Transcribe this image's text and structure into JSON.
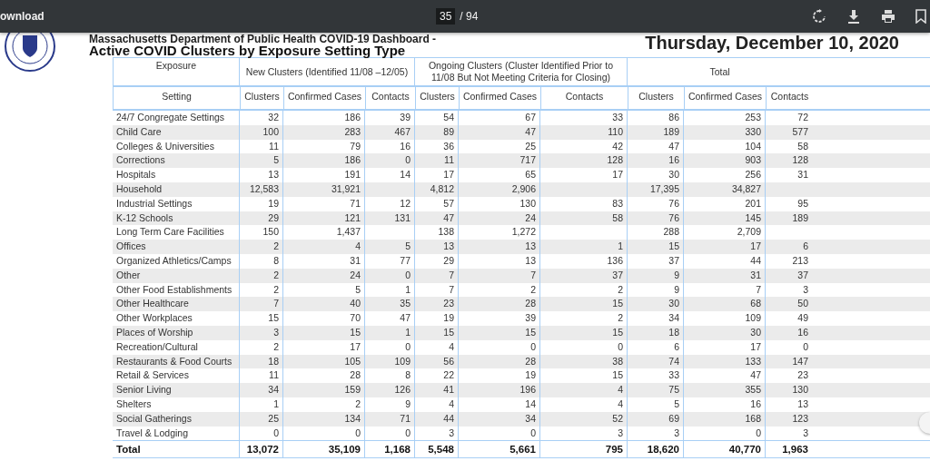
{
  "toolbar": {
    "title": "ownload",
    "page": "35",
    "page_count": "/ 94"
  },
  "header": {
    "agency": "Massachusetts Department of Public Health COVID-19 Dashboard -",
    "date": "Thursday, December 10, 2020",
    "title": "Active COVID Clusters by Exposure Setting Type"
  },
  "table": {
    "groups": [
      {
        "label": "Exposure"
      },
      {
        "label": "New Clusters (Identified 11/08 –12/05)"
      },
      {
        "label": "Ongoing Clusters (Cluster Identified Prior to 11/08 But Not Meeting Criteria for Closing)"
      },
      {
        "label": "Total"
      }
    ],
    "columns": [
      "Setting",
      "Clusters",
      "Confirmed Cases",
      "Contacts",
      "Clusters",
      "Confirmed Cases",
      "Contacts",
      "Clusters",
      "Confirmed Cases",
      "Contacts"
    ],
    "rows": [
      {
        "setting": "24/7 Congregate Settings",
        "new_clusters": "32",
        "new_cases": "186",
        "new_contacts": "39",
        "ongoing_clusters": "54",
        "ongoing_cases": "67",
        "ongoing_contacts": "33",
        "total_clusters": "86",
        "total_cases": "253",
        "total_contacts": "72"
      },
      {
        "setting": "Child Care",
        "new_clusters": "100",
        "new_cases": "283",
        "new_contacts": "467",
        "ongoing_clusters": "89",
        "ongoing_cases": "47",
        "ongoing_contacts": "110",
        "total_clusters": "189",
        "total_cases": "330",
        "total_contacts": "577"
      },
      {
        "setting": "Colleges & Universities",
        "new_clusters": "11",
        "new_cases": "79",
        "new_contacts": "16",
        "ongoing_clusters": "36",
        "ongoing_cases": "25",
        "ongoing_contacts": "42",
        "total_clusters": "47",
        "total_cases": "104",
        "total_contacts": "58"
      },
      {
        "setting": "Corrections",
        "new_clusters": "5",
        "new_cases": "186",
        "new_contacts": "0",
        "ongoing_clusters": "11",
        "ongoing_cases": "717",
        "ongoing_contacts": "128",
        "total_clusters": "16",
        "total_cases": "903",
        "total_contacts": "128"
      },
      {
        "setting": "Hospitals",
        "new_clusters": "13",
        "new_cases": "191",
        "new_contacts": "14",
        "ongoing_clusters": "17",
        "ongoing_cases": "65",
        "ongoing_contacts": "17",
        "total_clusters": "30",
        "total_cases": "256",
        "total_contacts": "31"
      },
      {
        "setting": "Household",
        "new_clusters": "12,583",
        "new_cases": "31,921",
        "ongoing_clusters": "4,812",
        "ongoing_cases": "2,906",
        "total_clusters": "17,395",
        "total_cases": "34,827"
      },
      {
        "setting": "Industrial Settings",
        "new_clusters": "19",
        "new_cases": "71",
        "new_contacts": "12",
        "ongoing_clusters": "57",
        "ongoing_cases": "130",
        "ongoing_contacts": "83",
        "total_clusters": "76",
        "total_cases": "201",
        "total_contacts": "95"
      },
      {
        "setting": "K-12 Schools",
        "new_clusters": "29",
        "new_cases": "121",
        "new_contacts": "131",
        "ongoing_clusters": "47",
        "ongoing_cases": "24",
        "ongoing_contacts": "58",
        "total_clusters": "76",
        "total_cases": "145",
        "total_contacts": "189"
      },
      {
        "setting": "Long Term Care Facilities",
        "new_clusters": "150",
        "new_cases": "1,437",
        "ongoing_clusters": "138",
        "ongoing_cases": "1,272",
        "total_clusters": "288",
        "total_cases": "2,709"
      },
      {
        "setting": "Offices",
        "new_clusters": "2",
        "new_cases": "4",
        "new_contacts": "5",
        "ongoing_clusters": "13",
        "ongoing_cases": "13",
        "ongoing_contacts": "1",
        "total_clusters": "15",
        "total_cases": "17",
        "total_contacts": "6"
      },
      {
        "setting": "Organized Athletics/Camps",
        "new_clusters": "8",
        "new_cases": "31",
        "new_contacts": "77",
        "ongoing_clusters": "29",
        "ongoing_cases": "13",
        "ongoing_contacts": "136",
        "total_clusters": "37",
        "total_cases": "44",
        "total_contacts": "213"
      },
      {
        "setting": "Other",
        "new_clusters": "2",
        "new_cases": "24",
        "new_contacts": "0",
        "ongoing_clusters": "7",
        "ongoing_cases": "7",
        "ongoing_contacts": "37",
        "total_clusters": "9",
        "total_cases": "31",
        "total_contacts": "37"
      },
      {
        "setting": "Other Food Establishments",
        "new_clusters": "2",
        "new_cases": "5",
        "new_contacts": "1",
        "ongoing_clusters": "7",
        "ongoing_cases": "2",
        "ongoing_contacts": "2",
        "total_clusters": "9",
        "total_cases": "7",
        "total_contacts": "3"
      },
      {
        "setting": "Other Healthcare",
        "new_clusters": "7",
        "new_cases": "40",
        "new_contacts": "35",
        "ongoing_clusters": "23",
        "ongoing_cases": "28",
        "ongoing_contacts": "15",
        "total_clusters": "30",
        "total_cases": "68",
        "total_contacts": "50"
      },
      {
        "setting": "Other Workplaces",
        "new_clusters": "15",
        "new_cases": "70",
        "new_contacts": "47",
        "ongoing_clusters": "19",
        "ongoing_cases": "39",
        "ongoing_contacts": "2",
        "total_clusters": "34",
        "total_cases": "109",
        "total_contacts": "49"
      },
      {
        "setting": "Places of Worship",
        "new_clusters": "3",
        "new_cases": "15",
        "new_contacts": "1",
        "ongoing_clusters": "15",
        "ongoing_cases": "15",
        "ongoing_contacts": "15",
        "total_clusters": "18",
        "total_cases": "30",
        "total_contacts": "16"
      },
      {
        "setting": "Recreation/Cultural",
        "new_clusters": "2",
        "new_cases": "17",
        "new_contacts": "0",
        "ongoing_clusters": "4",
        "ongoing_cases": "0",
        "ongoing_contacts": "0",
        "total_clusters": "6",
        "total_cases": "17",
        "total_contacts": "0"
      },
      {
        "setting": "Restaurants & Food Courts",
        "new_clusters": "18",
        "new_cases": "105",
        "new_contacts": "109",
        "ongoing_clusters": "56",
        "ongoing_cases": "28",
        "ongoing_contacts": "38",
        "total_clusters": "74",
        "total_cases": "133",
        "total_contacts": "147"
      },
      {
        "setting": "Retail & Services",
        "new_clusters": "11",
        "new_cases": "28",
        "new_contacts": "8",
        "ongoing_clusters": "22",
        "ongoing_cases": "19",
        "ongoing_contacts": "15",
        "total_clusters": "33",
        "total_cases": "47",
        "total_contacts": "23"
      },
      {
        "setting": "Senior Living",
        "new_clusters": "34",
        "new_cases": "159",
        "new_contacts": "126",
        "ongoing_clusters": "41",
        "ongoing_cases": "196",
        "ongoing_contacts": "4",
        "total_clusters": "75",
        "total_cases": "355",
        "total_contacts": "130"
      },
      {
        "setting": "Shelters",
        "new_clusters": "1",
        "new_cases": "2",
        "new_contacts": "9",
        "ongoing_clusters": "4",
        "ongoing_cases": "14",
        "ongoing_contacts": "4",
        "total_clusters": "5",
        "total_cases": "16",
        "total_contacts": "13"
      },
      {
        "setting": "Social Gatherings",
        "new_clusters": "25",
        "new_cases": "134",
        "new_contacts": "71",
        "ongoing_clusters": "44",
        "ongoing_cases": "34",
        "ongoing_contacts": "52",
        "total_clusters": "69",
        "total_cases": "168",
        "total_contacts": "123"
      },
      {
        "setting": "Travel & Lodging",
        "new_clusters": "0",
        "new_cases": "0",
        "new_contacts": "0",
        "ongoing_clusters": "3",
        "ongoing_cases": "0",
        "ongoing_contacts": "3",
        "total_clusters": "3",
        "total_cases": "0",
        "total_contacts": "3"
      }
    ],
    "total": {
      "setting": "Total",
      "new_clusters": "13,072",
      "new_cases": "35,109",
      "new_contacts": "1,168",
      "ongoing_clusters": "5,548",
      "ongoing_cases": "5,661",
      "ongoing_contacts": "795",
      "total_clusters": "18,620",
      "total_cases": "40,770",
      "total_contacts": "1,963"
    }
  }
}
